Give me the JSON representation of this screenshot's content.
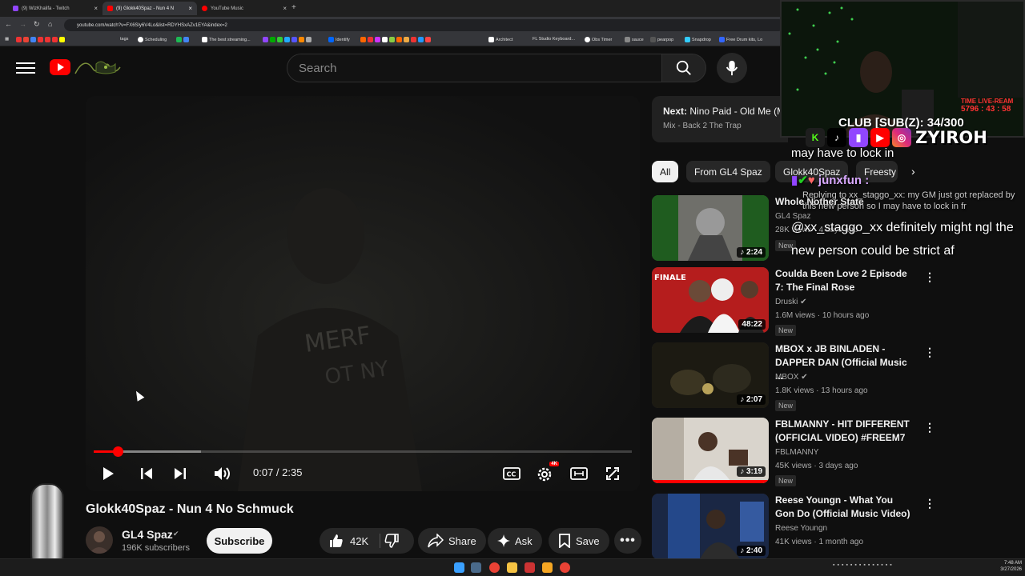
{
  "browser": {
    "tabs": [
      {
        "title": "(9) WizKhalifa - Twitch",
        "favicon_color": "#9146ff"
      },
      {
        "title": "(9) Glokk40Spaz - Nun 4 N",
        "favicon_color": "#ff0000"
      },
      {
        "title": "YouTube Music",
        "favicon_color": "#ff0000"
      }
    ],
    "new_tab": "+",
    "url": "youtube.com/watch?v=FX6Sly6V4Lo&list=RDYHSxAZv1EYA&index=2",
    "bookmarks": [
      "tags",
      "Scheduling",
      "The best streaming...",
      "Identify",
      "Architect",
      "FL Studio Keyboard...",
      "Obs Timer",
      "sauce",
      "pearpop",
      "Snapdrop",
      "Free Drum kits, Lo"
    ]
  },
  "header": {
    "search_placeholder": "Search",
    "icons": [
      "menu-icon",
      "youtube-logo",
      "search-icon",
      "mic-icon"
    ]
  },
  "player": {
    "current_time": "0:07",
    "duration": "2:35",
    "time_display": "0:07 / 2:35",
    "progress_fraction": 0.045,
    "buffered_fraction": 0.2,
    "settings_badge": "4K"
  },
  "video": {
    "title": "Glokk40Spaz - Nun 4 No Schmuck",
    "channel": "GL4 Spaz",
    "subscribers": "196K subscribers",
    "subscribe_label": "Subscribe",
    "likes": "42K",
    "share_label": "Share",
    "ask_label": "Ask",
    "save_label": "Save"
  },
  "sidebar": {
    "next_label": "Next:",
    "next_title": "Nino Paid - Old Me (M",
    "next_mix": "Mix - Back 2 The Trap",
    "chips": [
      "All",
      "From GL4 Spaz",
      "Glokk40Spaz",
      "Freesty"
    ],
    "recommendations": [
      {
        "title": "Whole Nother State",
        "channel": "GL4 Spaz",
        "views": "28K views · 4 days ago",
        "badge": "New",
        "duration": "2:24",
        "music": true
      },
      {
        "title": "Coulda Been Love 2 Episode 7: The Final Rose",
        "channel": "Druski",
        "views": "1.6M views · 10 hours ago",
        "badge": "New",
        "duration": "48:22",
        "music": false
      },
      {
        "title": "MBOX x JB BINLADEN - DAPPER DAN (Official Music ...",
        "channel": "MBOX",
        "views": "1.8K views · 13 hours ago",
        "badge": "New",
        "duration": "2:07",
        "music": true
      },
      {
        "title": "FBLMANNY - HIT DIFFERENT (OFFICIAL VIDEO) #FREEM7",
        "channel": "FBLMANNY",
        "views": "45K views · 3 days ago",
        "badge": "New",
        "duration": "3:19",
        "music": true
      },
      {
        "title": "Reese Youngn - What You Gon Do (Official Music Video)",
        "channel": "Reese Youngn",
        "views": "41K views · 1 month ago",
        "badge": "",
        "duration": "2:40",
        "music": true
      }
    ]
  },
  "stream_overlay": {
    "timer_label": "TIME LIVE-REAM",
    "timer_value": "5796 : 43 : 58",
    "club_text": "CLUB [SUB(Z): 34/300",
    "handle": "ZYIROH",
    "chat_prev": "may have to lock in",
    "chat_user": "junxfun :",
    "chat_reply": "Replying to xx_staggo_xx: my GM just got replaced by this new person so I may have to lock in fr",
    "chat_message": "@xx_staggo_xx definitely might ngl the new person could be strict af"
  },
  "taskbar": {
    "time": "7:48 AM",
    "date": "3/27/2026"
  }
}
